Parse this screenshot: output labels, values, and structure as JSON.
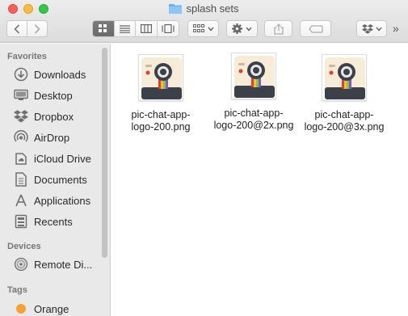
{
  "window": {
    "title": "splash sets"
  },
  "toolbar": {
    "back_icon": "chevron-left-icon",
    "forward_icon": "chevron-right-icon",
    "view_modes": [
      "icon-view",
      "list-view",
      "column-view",
      "cover-flow-view"
    ],
    "active_view": "icon-view",
    "more_label": "»"
  },
  "sidebar": {
    "favorites_header": "Favorites",
    "favorites": [
      {
        "label": "Downloads",
        "icon": "downloads-icon"
      },
      {
        "label": "Desktop",
        "icon": "desktop-icon"
      },
      {
        "label": "Dropbox",
        "icon": "dropbox-icon"
      },
      {
        "label": "AirDrop",
        "icon": "airdrop-icon"
      },
      {
        "label": "iCloud Drive",
        "icon": "icloud-icon"
      },
      {
        "label": "Documents",
        "icon": "documents-icon"
      },
      {
        "label": "Applications",
        "icon": "applications-icon"
      },
      {
        "label": "Recents",
        "icon": "recents-icon"
      }
    ],
    "devices_header": "Devices",
    "devices": [
      {
        "label": "Remote Di...",
        "icon": "disc-icon"
      }
    ],
    "tags_header": "Tags",
    "tags": [
      {
        "label": "Orange",
        "color": "#f7a033"
      }
    ]
  },
  "files": [
    {
      "name_line1": "pic-chat-app-",
      "name_line2": "logo-200.png"
    },
    {
      "name_line1": "pic-chat-app-",
      "name_line2": "logo-200@2x.png"
    },
    {
      "name_line1": "pic-chat-app-",
      "name_line2": "logo-200@3x.png"
    }
  ],
  "colors": {
    "accent": "#2a7de1",
    "folder": "#6bb3f0"
  }
}
